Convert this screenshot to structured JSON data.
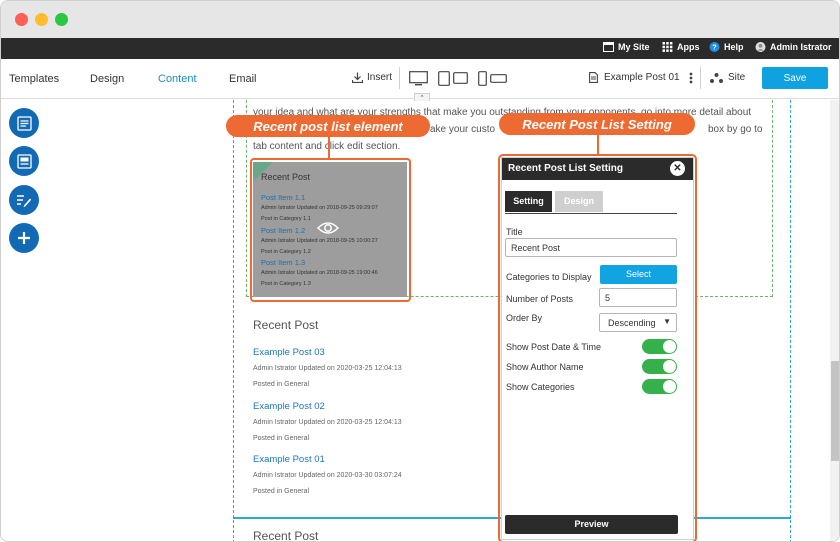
{
  "colors": {
    "accent": "#1a8dc7",
    "save": "#0fa1e0",
    "callout": "#ee6a33",
    "toggle_on": "#35b04a",
    "dark": "#2b2b2b",
    "sidebar_button": "#136ab4"
  },
  "window": {
    "traffic_lights": [
      "#fe5f57",
      "#febc2e",
      "#28c840"
    ]
  },
  "topbar": {
    "my_site": "My Site",
    "apps": "Apps",
    "help": "Help",
    "user": "Admin Istrator"
  },
  "navbar": {
    "tabs": [
      "Templates",
      "Design",
      "Content",
      "Email"
    ],
    "active_tab": "Content",
    "insert": "Insert",
    "page_name": "Example Post 01",
    "site": "Site",
    "save": "Save"
  },
  "sidebar": {
    "buttons": [
      "pages-icon",
      "layout-icon",
      "edit-list-icon",
      "add-icon"
    ]
  },
  "content": {
    "paragraph": "your idea and what are your strengths that make you outstanding from your opponents, go into more detail about ... ake your custo ... box by go to tab content and click edit section.",
    "paragraph_line1": "your idea and what are your strengths that make you outstanding from your opponents, go into more detail about",
    "paragraph_line2_end": "ake your custo",
    "paragraph_line2_tail": "box by go to",
    "paragraph_line3": "tab content and click edit section.",
    "element_preview": {
      "title": "Recent Post",
      "items": [
        {
          "title": "Post Item 1.1",
          "meta": "Admin Istrator Updated on 2018-09-25 09:29:07",
          "category": "Post in Category 1.1"
        },
        {
          "title": "Post Item 1.2",
          "meta": "Admin Istrator Updated on 2018-09-25 10:00:27",
          "category": "Post in Category 1.2"
        },
        {
          "title": "Post Item 1.3",
          "meta": "Admin Istrator Updated on 2018-09-25 19:00:46",
          "category": "Post in Category 1.3"
        }
      ]
    },
    "recent_post_heading": "Recent Post",
    "posts": [
      {
        "title": "Example Post 03",
        "meta": "Admin Istrator Updated on 2020-03-25 12:04:13",
        "category": "Posted in General"
      },
      {
        "title": "Example Post 02",
        "meta": "Admin Istrator Updated on 2020-03-25 12:04:13",
        "category": "Posted in General"
      },
      {
        "title": "Example Post 01",
        "meta": "Admin Istrator Updated on 2020-03-30 03:07:24",
        "category": "Posted in General"
      }
    ],
    "bottom_heading": "Recent Post"
  },
  "callouts": {
    "element": "Recent post list element",
    "setting": "Recent Post List Setting"
  },
  "panel": {
    "title": "Recent Post List Setting",
    "close": "✕",
    "tabs": [
      "Setting",
      "Design"
    ],
    "active_tab": "Setting",
    "title_label": "Title",
    "title_value": "Recent Post",
    "categories_label": "Categories to Display",
    "select_label": "Select",
    "number_label": "Number of Posts",
    "number_value": "5",
    "order_label": "Order By",
    "order_value": "Descending",
    "toggles": [
      {
        "label": "Show Post Date & Time",
        "on": true
      },
      {
        "label": "Show Author Name",
        "on": true
      },
      {
        "label": "Show Categories",
        "on": true
      }
    ],
    "preview": "Preview"
  }
}
